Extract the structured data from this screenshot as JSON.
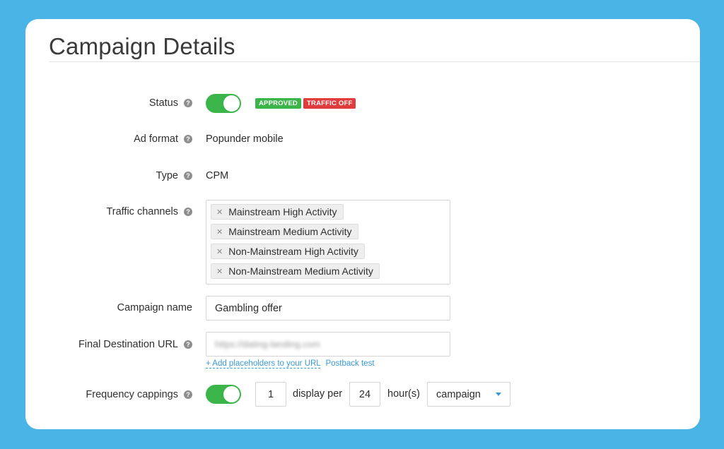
{
  "page": {
    "title": "Campaign Details"
  },
  "fields": {
    "status": {
      "label": "Status",
      "enabled": true,
      "badges": [
        {
          "text": "APPROVED",
          "color": "#3bb54a"
        },
        {
          "text": "TRAFFIC OFF",
          "color": "#e23b3b"
        }
      ]
    },
    "ad_format": {
      "label": "Ad format",
      "value": "Popunder mobile"
    },
    "type": {
      "label": "Type",
      "value": "CPM"
    },
    "traffic_channels": {
      "label": "Traffic channels",
      "tags": [
        "Mainstream High Activity",
        "Mainstream Medium Activity",
        "Non-Mainstream High Activity",
        "Non-Mainstream Medium Activity"
      ]
    },
    "campaign_name": {
      "label": "Campaign name",
      "value": "Gambling offer"
    },
    "final_destination_url": {
      "label": "Final Destination URL",
      "value": "https://dating-landing.com",
      "add_placeholders_link": "+ Add placeholders to your URL",
      "postback_test_link": "Postback test"
    },
    "frequency_cappings": {
      "label": "Frequency cappings",
      "enabled": true,
      "count": "1",
      "display_per_text": "display per",
      "hours": "24",
      "hours_unit_text": "hour(s)",
      "scope_selected": "campaign"
    }
  },
  "colors": {
    "background": "#4ab4e6",
    "toggle_on": "#3bb54a",
    "link": "#3a9ad9"
  }
}
